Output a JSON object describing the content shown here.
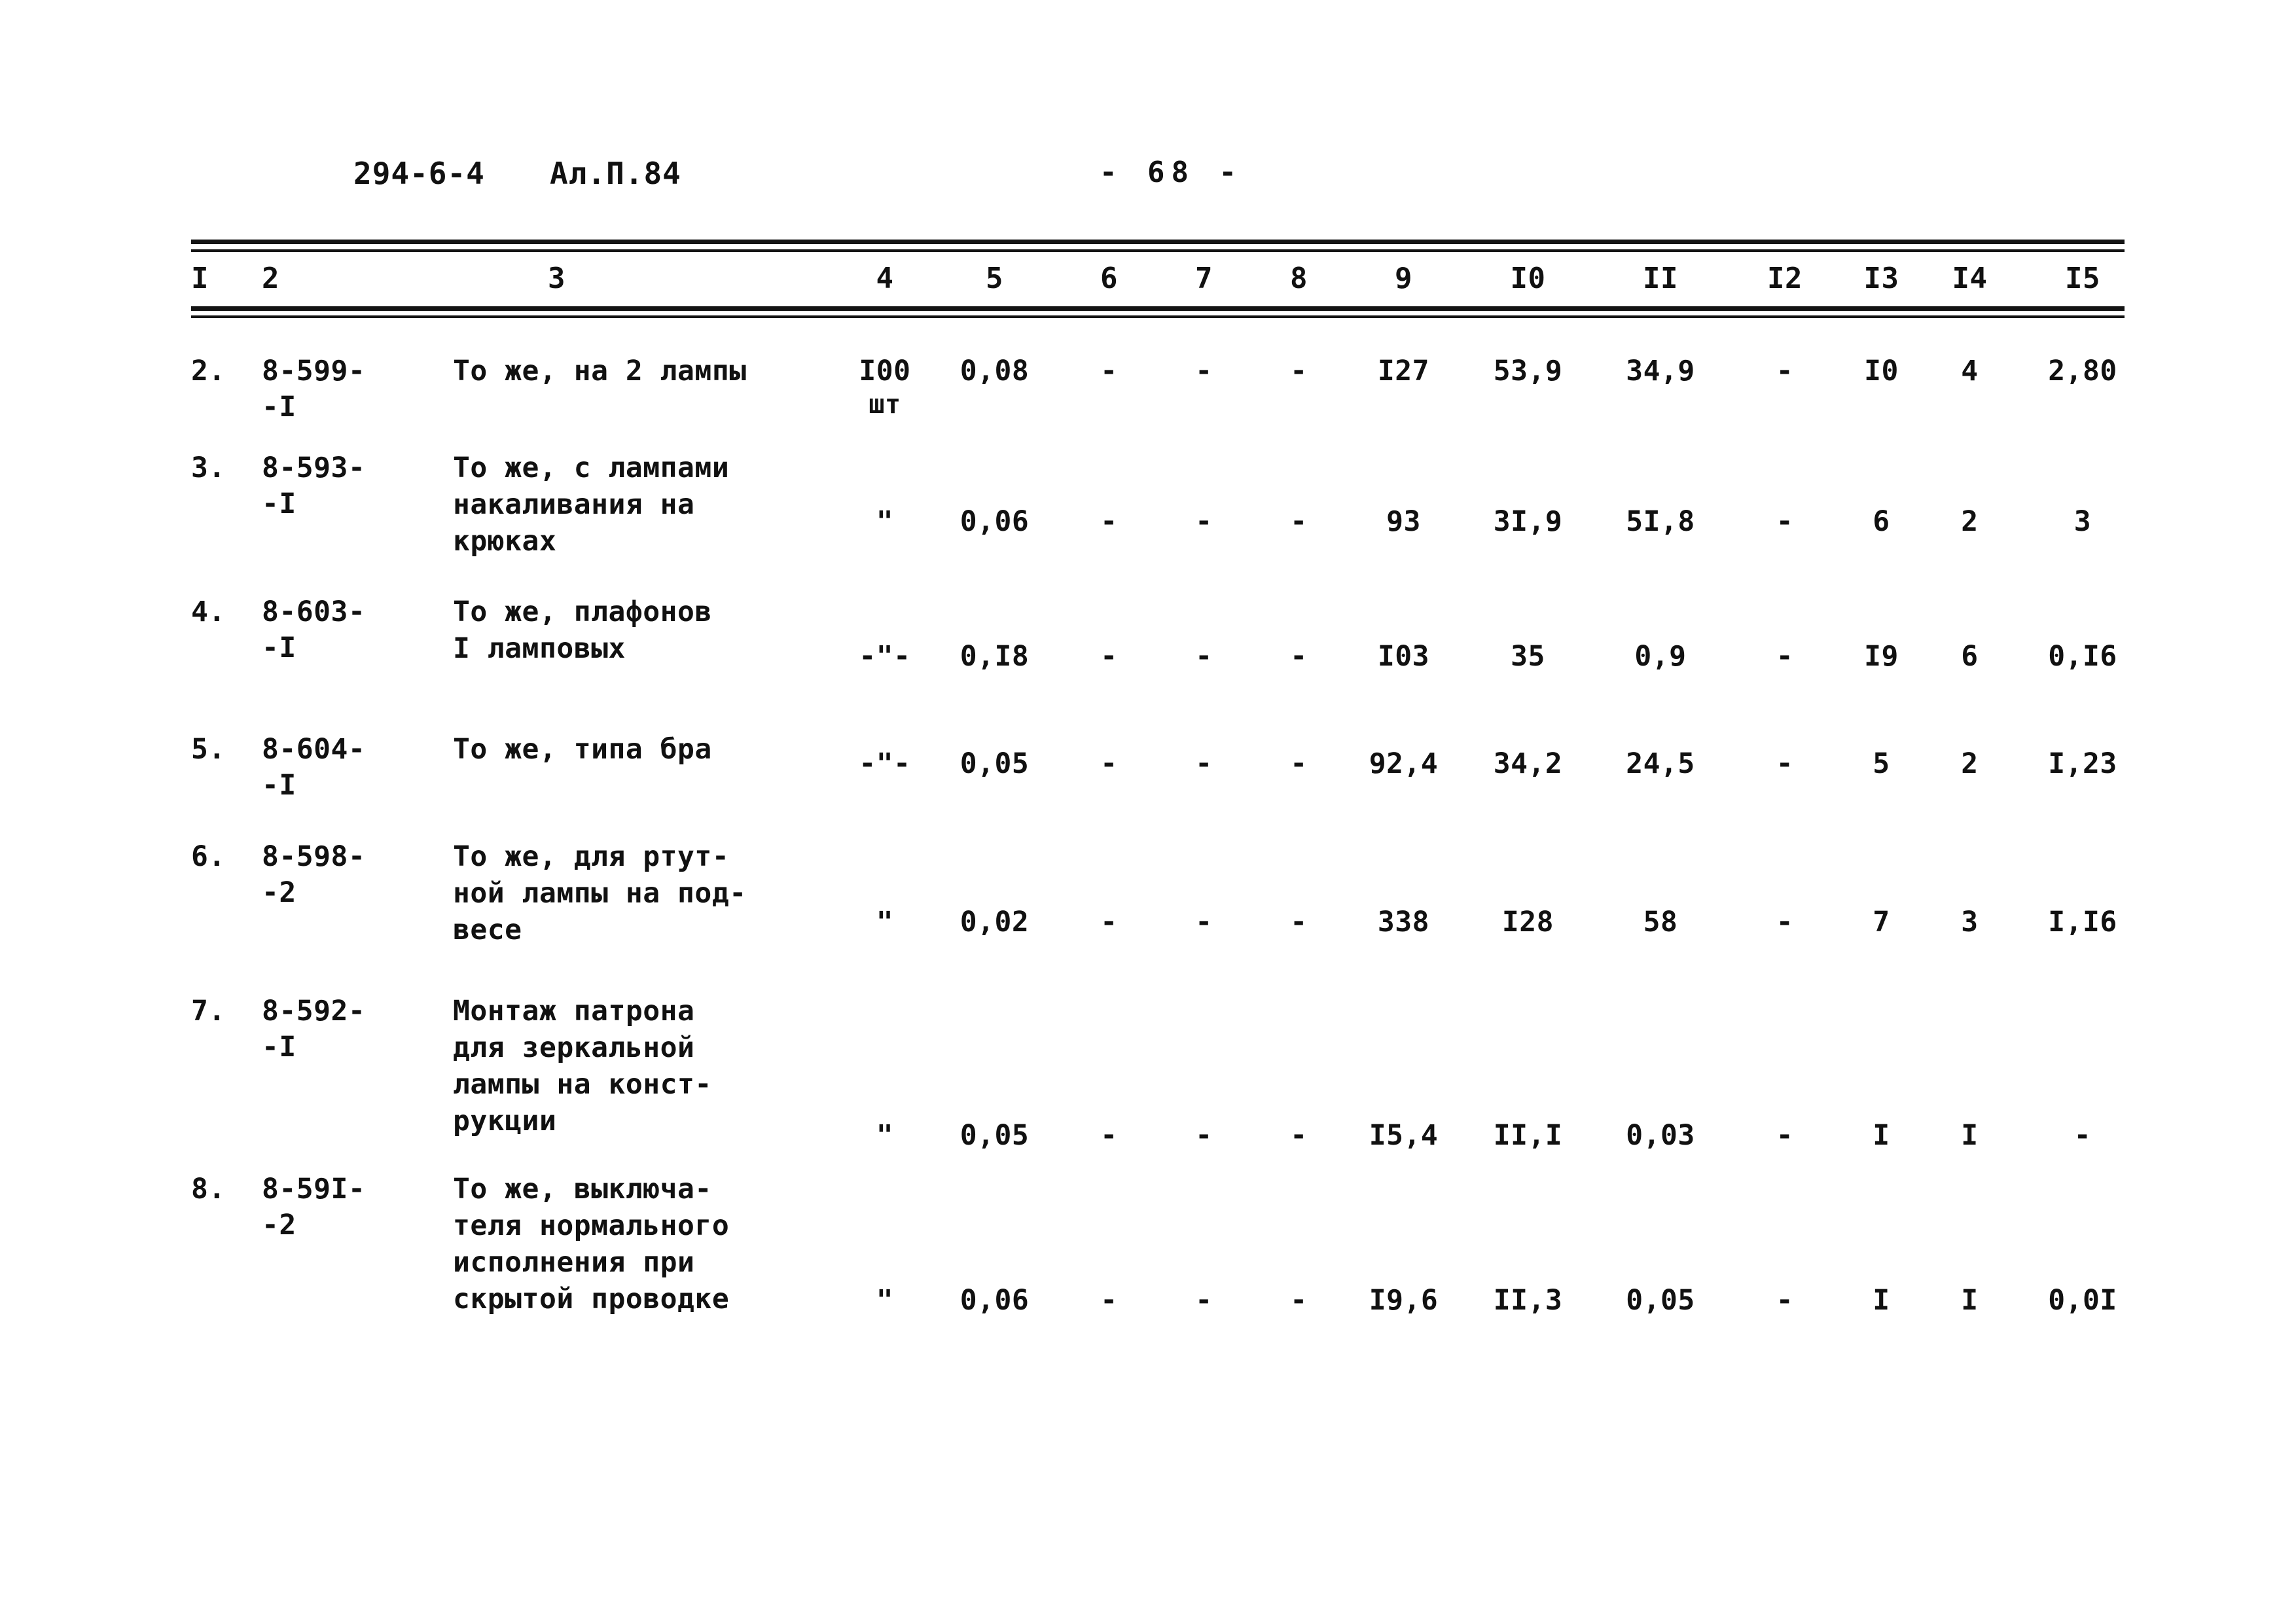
{
  "header": {
    "doc_code": "294-6-4",
    "album": "Ал.П.84",
    "page_number": "- 68 -"
  },
  "table": {
    "column_headers": [
      "I",
      "2",
      "3",
      "4",
      "5",
      "6",
      "7",
      "8",
      "9",
      "I0",
      "II",
      "I2",
      "I3",
      "I4",
      "I5"
    ],
    "rows": [
      {
        "no": "2.",
        "code": "8-599-\n-I",
        "name": "То же, на 2 лампы",
        "unit": "I00",
        "unit_sub": "шт",
        "c5": "0,08",
        "c6": "-",
        "c7": "-",
        "c8": "-",
        "c9": "I27",
        "c10": "53,9",
        "c11": "34,9",
        "c12": "-",
        "c13": "I0",
        "c14": "4",
        "c15": "2,80"
      },
      {
        "no": "3.",
        "code": "8-593-\n-I",
        "name": "То же, с лампами\nнакаливания на\nкрюках",
        "unit": "\"",
        "unit_sub": "",
        "c5": "0,06",
        "c6": "-",
        "c7": "-",
        "c8": "-",
        "c9": "93",
        "c10": "3I,9",
        "c11": "5I,8",
        "c12": "-",
        "c13": "6",
        "c14": "2",
        "c15": "3"
      },
      {
        "no": "4.",
        "code": "8-603-\n-I",
        "name": "То же, плафонов\nI ламповых",
        "unit": "-\"-",
        "unit_sub": "",
        "c5": "0,I8",
        "c6": "-",
        "c7": "-",
        "c8": "-",
        "c9": "I03",
        "c10": "35",
        "c11": "0,9",
        "c12": "-",
        "c13": "I9",
        "c14": "6",
        "c15": "0,I6"
      },
      {
        "no": "5.",
        "code": "8-604-\n-I",
        "name": "То же, типа бра",
        "unit": "-\"-",
        "unit_sub": "",
        "c5": "0,05",
        "c6": "-",
        "c7": "-",
        "c8": "-",
        "c9": "92,4",
        "c10": "34,2",
        "c11": "24,5",
        "c12": "-",
        "c13": "5",
        "c14": "2",
        "c15": "I,23"
      },
      {
        "no": "6.",
        "code": "8-598-\n-2",
        "name": "То же, для ртут-\nной лампы на под-\nвесе",
        "unit": "\"",
        "unit_sub": "",
        "c5": "0,02",
        "c6": "-",
        "c7": "-",
        "c8": "-",
        "c9": "338",
        "c10": "I28",
        "c11": "58",
        "c12": "-",
        "c13": "7",
        "c14": "3",
        "c15": "I,I6"
      },
      {
        "no": "7.",
        "code": "8-592-\n-I",
        "name": "Монтаж патрона\nдля зеркальной\nлампы на конст-\nрукции",
        "unit": "\"",
        "unit_sub": "",
        "c5": "0,05",
        "c6": "-",
        "c7": "-",
        "c8": "-",
        "c9": "I5,4",
        "c10": "II,I",
        "c11": "0,03",
        "c12": "-",
        "c13": "I",
        "c14": "I",
        "c15": "-"
      },
      {
        "no": "8.",
        "code": "8-59I-\n-2",
        "name": "То же, выключа-\nтеля нормального\nисполнения при\nскрытой проводке",
        "unit": "\"",
        "unit_sub": "",
        "c5": "0,06",
        "c6": "-",
        "c7": "-",
        "c8": "-",
        "c9": "I9,6",
        "c10": "II,3",
        "c11": "0,05",
        "c12": "-",
        "c13": "I",
        "c14": "I",
        "c15": "0,0I"
      }
    ]
  }
}
